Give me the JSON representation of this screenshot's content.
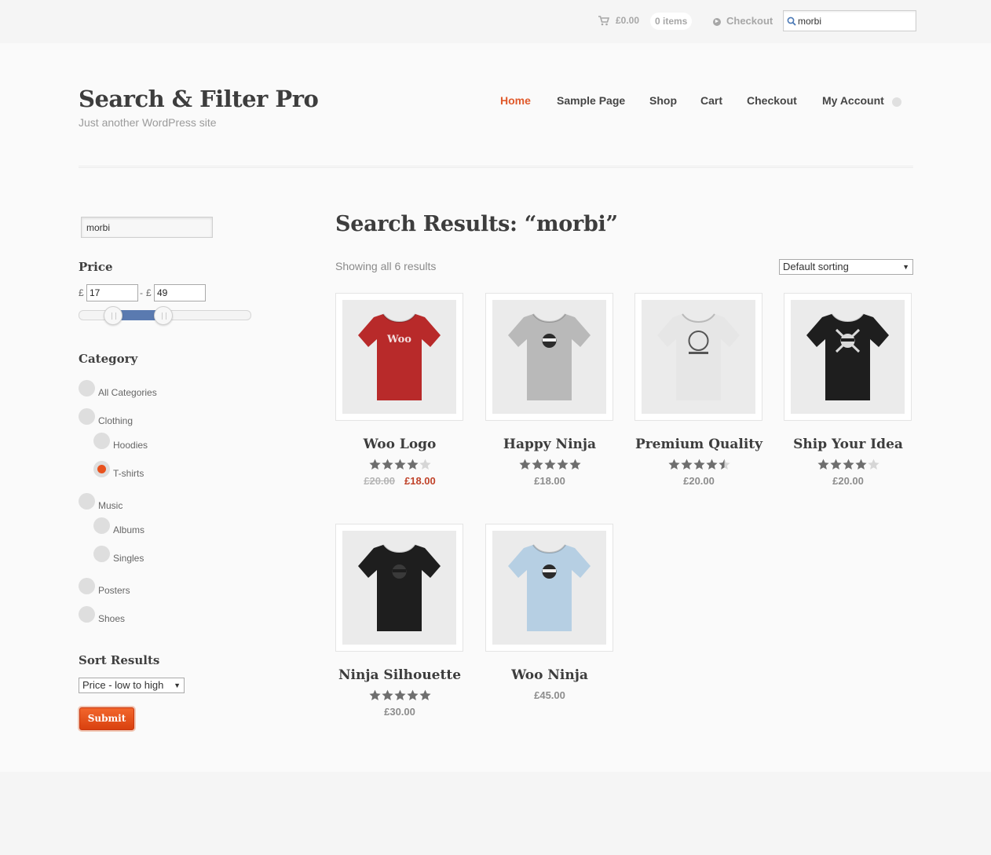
{
  "topbar": {
    "cart_amount": "£0.00",
    "cart_items": "0 items",
    "checkout_label": "Checkout",
    "search_value": "morbi"
  },
  "site": {
    "title": "Search & Filter Pro",
    "description": "Just another WordPress site"
  },
  "nav": [
    {
      "label": "Home",
      "active": true
    },
    {
      "label": "Sample Page",
      "active": false
    },
    {
      "label": "Shop",
      "active": false
    },
    {
      "label": "Cart",
      "active": false
    },
    {
      "label": "Checkout",
      "active": false
    },
    {
      "label": "My Account",
      "active": false
    }
  ],
  "sidebar": {
    "search_value": "morbi",
    "price": {
      "heading": "Price",
      "currency": "£",
      "separator": "-",
      "min_value": "17",
      "max_value": "49"
    },
    "category": {
      "heading": "Category",
      "items": [
        {
          "label": "All Categories",
          "checked": false
        },
        {
          "label": "Clothing",
          "checked": false
        },
        {
          "label": "Hoodies",
          "checked": false
        },
        {
          "label": "T-shirts",
          "checked": true
        },
        {
          "label": "Music",
          "checked": false
        },
        {
          "label": "Albums",
          "checked": false
        },
        {
          "label": "Singles",
          "checked": false
        },
        {
          "label": "Posters",
          "checked": false
        },
        {
          "label": "Shoes",
          "checked": false
        }
      ]
    },
    "sort": {
      "heading": "Sort Results",
      "selected": "Price - low to high"
    },
    "submit_label": "Submit"
  },
  "results": {
    "title": "Search Results: “morbi”",
    "count_text": "Showing all 6 results",
    "sort_selected": "Default sorting"
  },
  "products": [
    {
      "title": "Woo Logo",
      "rating": 4,
      "old_price": "£20.00",
      "price": "£18.00",
      "shirt_color": "#b82a2a",
      "print": "Woo"
    },
    {
      "title": "Happy Ninja",
      "rating": 5,
      "old_price": "",
      "price": "£18.00",
      "shirt_color": "#b9b9b9",
      "print": "ninja"
    },
    {
      "title": "Premium Quality",
      "rating": 4.5,
      "old_price": "",
      "price": "£20.00",
      "shirt_color": "#e6e6e6",
      "print": "badge"
    },
    {
      "title": "Ship Your Idea",
      "rating": 4,
      "old_price": "",
      "price": "£20.00",
      "shirt_color": "#1e1e1e",
      "print": "skull"
    },
    {
      "title": "Ninja Silhouette",
      "rating": 5,
      "old_price": "",
      "price": "£30.00",
      "shirt_color": "#1e1e1e",
      "print": "silhouette"
    },
    {
      "title": "Woo Ninja",
      "rating": 0,
      "old_price": "",
      "price": "£45.00",
      "shirt_color": "#b6cfe3",
      "print": "ninja"
    }
  ],
  "colors": {
    "accent": "#e0592a",
    "slider_range": "#5a7ab0",
    "sale_price": "#c0432a",
    "star": "#6e6e6e"
  },
  "icons": [
    "cart-icon",
    "checkout-icon",
    "search-icon",
    "chevron-down-icon",
    "star-icon"
  ]
}
